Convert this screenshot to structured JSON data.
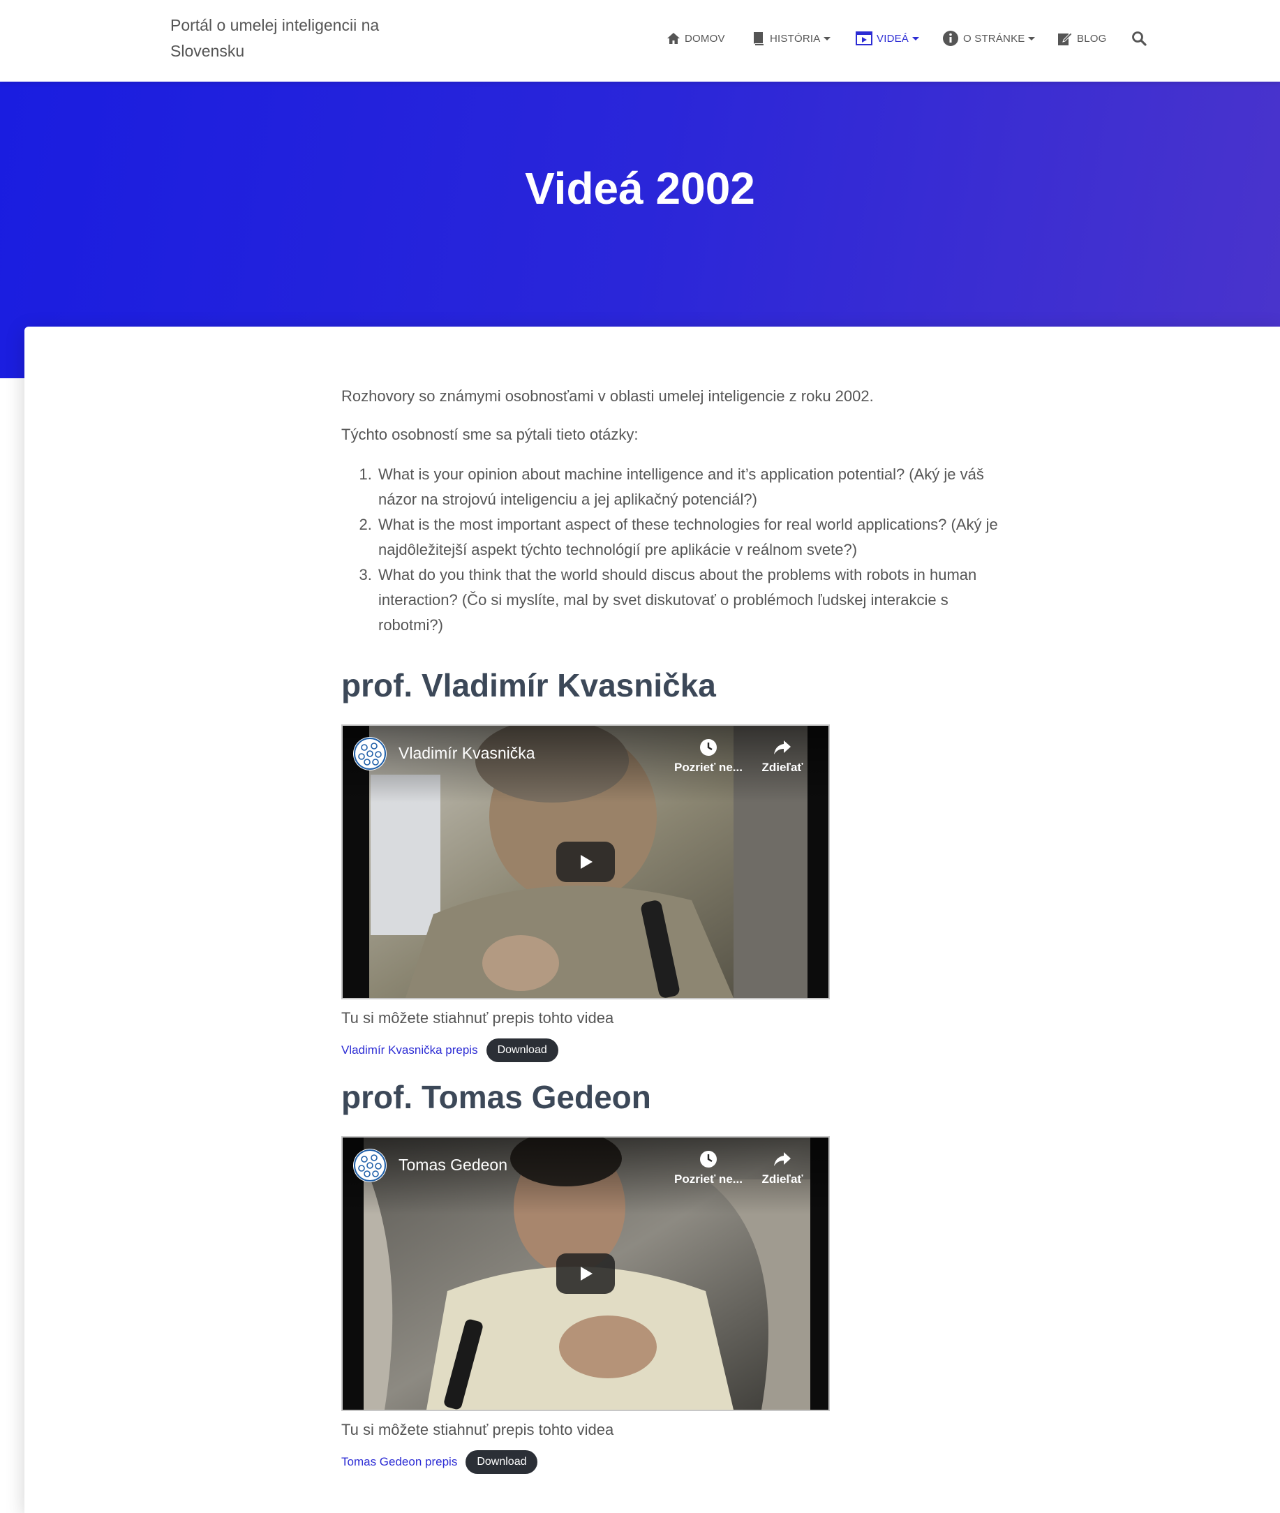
{
  "site": {
    "brand": "Portál o umelej inteligencii na Slovensku"
  },
  "nav": {
    "items": [
      {
        "label": "DOMOV",
        "icon": "home-icon"
      },
      {
        "label": "HISTÓRIA",
        "icon": "book-icon",
        "dropdown": true
      },
      {
        "label": "VIDEÁ",
        "icon": "film-icon",
        "dropdown": true,
        "active": true
      },
      {
        "label": "O STRÁNKE",
        "icon": "info-icon",
        "dropdown": true
      },
      {
        "label": "BLOG",
        "icon": "edit-icon"
      }
    ],
    "search_icon": "search-icon",
    "active_color": "#2c2cd4"
  },
  "hero": {
    "title": "Videá 2002"
  },
  "intro": {
    "p1": "Rozhovory so známymi osobnosťami v oblasti umelej inteligencie z roku 2002.",
    "p2": "Týchto osobností sme sa pýtali tieto otázky:",
    "questions": [
      "What is your opinion about machine intelligence and it’s application potential? (Aký je váš názor na strojovú inteligenciu a jej aplikačný potenciál?)",
      "What is the most important aspect of these technologies for real world applications? (Aký je najdôležitejší aspekt týchto technológií pre aplikácie v reálnom svete?)",
      "What do you think that the world should discus about the problems with robots in human interaction? (Čo si myslíte, mal by svet diskutovať o problémoch ľudskej interakcie s robotmi?)"
    ]
  },
  "people": [
    {
      "heading": "prof. Vladimír Kvasnička",
      "video_title": "Vladimír Kvasnička",
      "watch_later": "Pozrieť ne...",
      "share": "Zdieľať",
      "caption": "Tu si môžete stiahnuť prepis tohto videa",
      "link": "Vladimír Kvasnička prepis",
      "download": "Download"
    },
    {
      "heading": "prof. Tomas Gedeon",
      "video_title": "Tomas Gedeon",
      "watch_later": "Pozrieť ne...",
      "share": "Zdieľať",
      "caption": "Tu si môžete stiahnuť prepis tohto videa",
      "link": "Tomas Gedeon prepis",
      "download": "Download"
    }
  ]
}
